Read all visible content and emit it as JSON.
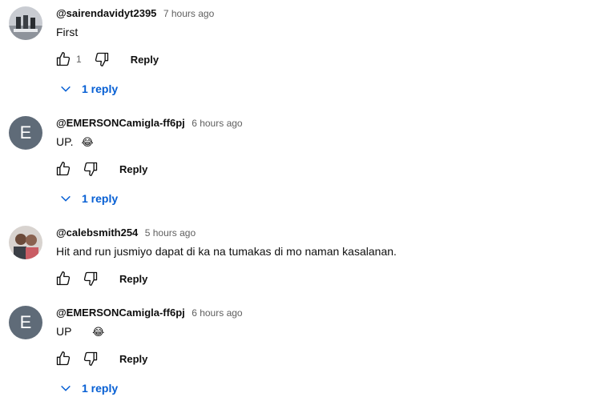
{
  "comments": [
    {
      "author": "@sairendavidyt2395",
      "time": "7 hours ago",
      "text": "First",
      "likes": "1",
      "reply_label": "Reply",
      "replies_label": "1 reply"
    },
    {
      "author": "@EMERSONCamigla-ff6pj",
      "time": "6 hours ago",
      "text": "UP.",
      "emoji": "😂",
      "avatar_letter": "E",
      "reply_label": "Reply",
      "replies_label": "1 reply"
    },
    {
      "author": "@calebsmith254",
      "time": "5 hours ago",
      "text": "Hit and run jusmiyo dapat di ka na tumakas di mo naman kasalanan.",
      "reply_label": "Reply"
    },
    {
      "author": "@EMERSONCamigla-ff6pj",
      "time": "6 hours ago",
      "text": "UP",
      "emoji": "😂",
      "avatar_letter": "E",
      "reply_label": "Reply",
      "replies_label": "1 reply"
    }
  ],
  "colors": {
    "link_blue": "#065fd4",
    "secondary_text": "#606060",
    "letter_avatar_bg": "#5f6b78"
  }
}
